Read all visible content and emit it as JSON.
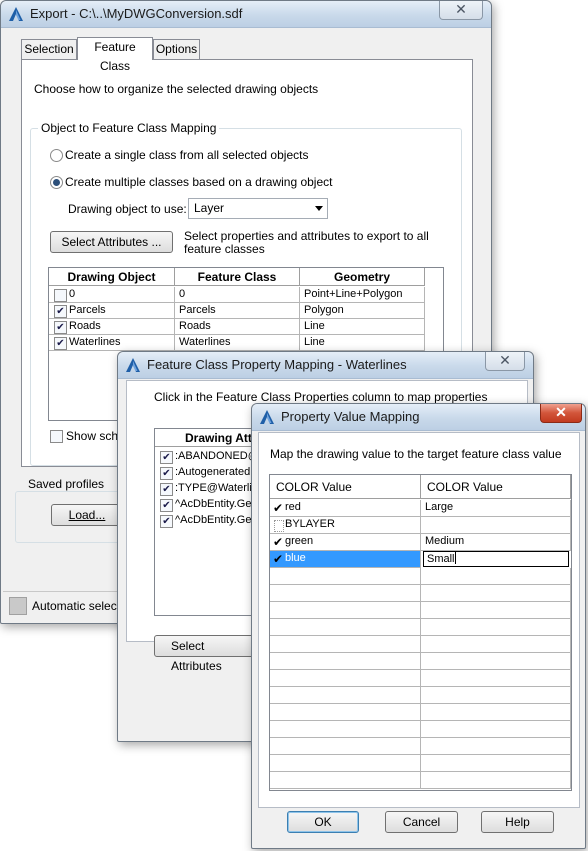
{
  "export_window": {
    "title": "Export - C:\\..\\MyDWGConversion.sdf",
    "close_symbol": "✕",
    "tabs": [
      {
        "label": "Selection"
      },
      {
        "label": "Feature Class"
      },
      {
        "label": "Options"
      }
    ],
    "active_tab": "Feature Class",
    "instruction": "Choose how to organize the selected drawing objects",
    "mapping_group_label": "Object to Feature Class Mapping",
    "radio_single": "Create a single class from all selected objects",
    "radio_multiple": "Create multiple classes based on a drawing object",
    "radio_selected": "multiple",
    "drawing_object_label": "Drawing object to use:",
    "drawing_object_value": "Layer",
    "select_attributes_label": "Select Attributes ...",
    "select_attributes_help": "Select properties and attributes to export to all feature classes",
    "table": {
      "headers": [
        "Drawing Object",
        "Feature Class",
        "Geometry"
      ],
      "rows": [
        {
          "checked": false,
          "object": "0",
          "feature_class": "0",
          "geometry": "Point+Line+Polygon"
        },
        {
          "checked": true,
          "object": "Parcels",
          "feature_class": "Parcels",
          "geometry": "Polygon"
        },
        {
          "checked": true,
          "object": "Roads",
          "feature_class": "Roads",
          "geometry": "Line"
        },
        {
          "checked": true,
          "object": "Waterlines",
          "feature_class": "Waterlines",
          "geometry": "Line"
        }
      ]
    },
    "show_schema_label": "Show sche",
    "saved_profiles_label": "Saved profiles",
    "load_button": "Load...",
    "status_text": "Automatic selec"
  },
  "fc_property_window": {
    "title": "Feature Class Property Mapping - Waterlines",
    "close_symbol": "✕",
    "instruction": "Click in the Feature Class Properties column to map properties",
    "table_header": "Drawing Attri",
    "rows": [
      {
        "checked": true,
        "label": ":ABANDONED@"
      },
      {
        "checked": true,
        "label": ":Autogenerated"
      },
      {
        "checked": true,
        "label": ":TYPE@Waterlin"
      },
      {
        "checked": true,
        "label": "^AcDbEntity.Ge"
      },
      {
        "checked": true,
        "label": "^AcDbEntity.Ge"
      }
    ],
    "select_attributes_label": "Select Attributes"
  },
  "pv_window": {
    "title": "Property Value Mapping",
    "close_symbol": "✕",
    "instruction": "Map the drawing value to the target feature class value",
    "headers": [
      "COLOR Value",
      "COLOR Value"
    ],
    "rows": [
      {
        "checked": true,
        "drawing_value": "red",
        "target_value": "Large"
      },
      {
        "checked": false,
        "drawing_value": "BYLAYER",
        "target_value": ""
      },
      {
        "checked": true,
        "drawing_value": "green",
        "target_value": "Medium"
      },
      {
        "checked": true,
        "drawing_value": "blue",
        "target_value": "Small",
        "selected": true,
        "editing": true
      }
    ],
    "ok_button": "OK",
    "cancel_button": "Cancel",
    "help_button": "Help"
  },
  "colors": {
    "selection_blue": "#3399ff",
    "titlebar_top": "#e5eef8",
    "close_red": "#c23a1f",
    "app_icon_blue": "#1f5fa8"
  },
  "icons": {
    "app_icon": "autodesk-a-icon",
    "close_icon": "x-icon",
    "checkmark": "check-icon"
  }
}
